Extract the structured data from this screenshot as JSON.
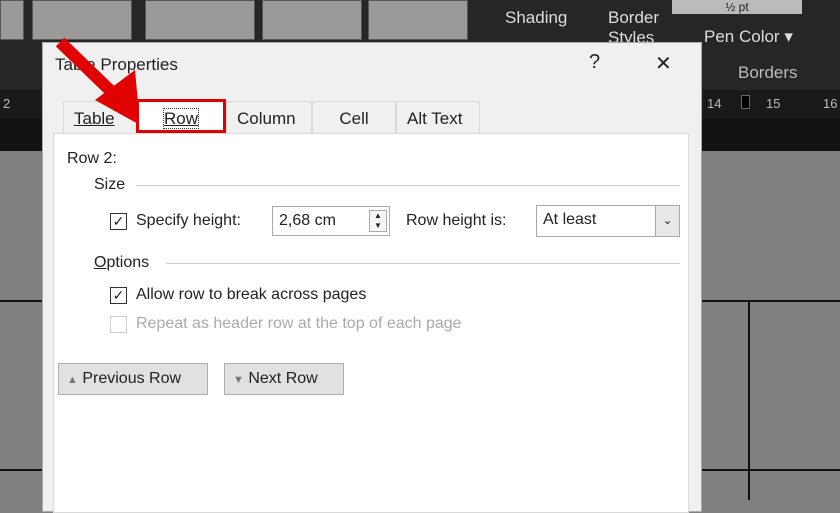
{
  "ribbon": {
    "shading": "Shading",
    "border_styles": "Border Styles",
    "pen_weight": "½ pt",
    "pen_color": "Pen Color",
    "borders": "Borders"
  },
  "ruler": {
    "left": "2",
    "r14": "14",
    "r15": "15",
    "r16": "16"
  },
  "dialog": {
    "title": "Table Properties",
    "help": "?",
    "close": "✕",
    "tabs": [
      {
        "label": "Table",
        "active": false
      },
      {
        "label": "Row",
        "active": true
      },
      {
        "label": "Column",
        "active": false
      },
      {
        "label": "Cell",
        "active": false
      },
      {
        "label": "Alt Text",
        "active": false
      }
    ],
    "row_label": "Row 2:",
    "size_group": "Size",
    "specify_height": {
      "label": "Specify height:",
      "checked": true,
      "value": "2,68 cm"
    },
    "row_height_is": {
      "label": "Row height is:",
      "value": "At least"
    },
    "options_group": "Options",
    "allow_break": {
      "label": "Allow row to break across pages",
      "checked": true
    },
    "repeat_header": {
      "label": "Repeat as header row at the top of each page",
      "checked": false,
      "disabled": true
    },
    "prev_row": "Previous Row",
    "next_row": "Next Row"
  },
  "annotation": {
    "arrow_color": "#e00000"
  }
}
